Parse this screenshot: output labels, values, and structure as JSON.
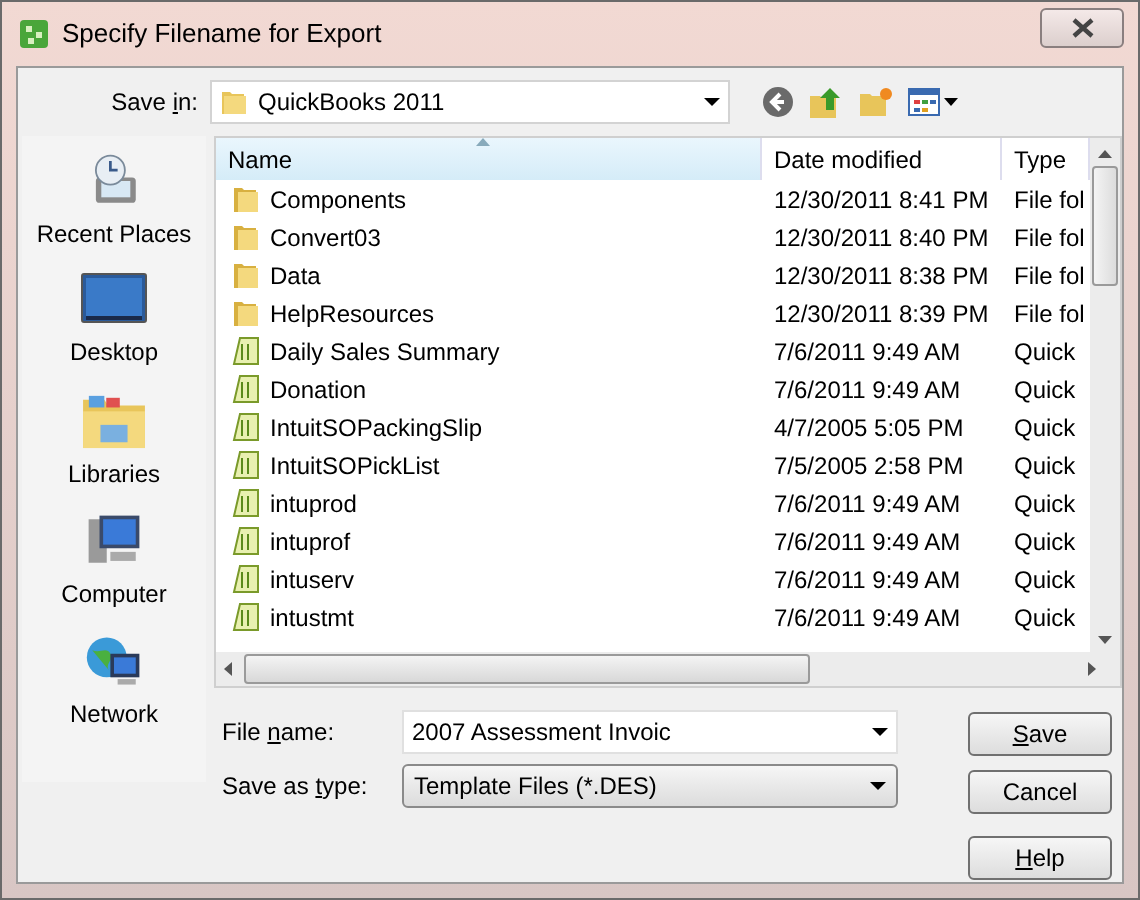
{
  "window": {
    "title": "Specify Filename for Export"
  },
  "save_in": {
    "label": [
      {
        "text": "Save ",
        "underlined": false
      },
      {
        "text": "i",
        "underlined": true
      },
      {
        "text": "n:",
        "underlined": false
      }
    ],
    "value": "QuickBooks 2011"
  },
  "places": [
    {
      "kind": "recent",
      "label": "Recent Places"
    },
    {
      "kind": "desktop",
      "label": "Desktop"
    },
    {
      "kind": "libraries",
      "label": "Libraries"
    },
    {
      "kind": "computer",
      "label": "Computer"
    },
    {
      "kind": "network",
      "label": "Network"
    }
  ],
  "columns": [
    {
      "label": "Name",
      "sorted": true
    },
    {
      "label": "Date modified",
      "sorted": false
    },
    {
      "label": "Type",
      "sorted": false
    }
  ],
  "files": [
    {
      "kind": "folder",
      "name": "Components",
      "date": "12/30/2011 8:41 PM",
      "type": "File fol"
    },
    {
      "kind": "folder",
      "name": "Convert03",
      "date": "12/30/2011 8:40 PM",
      "type": "File fol"
    },
    {
      "kind": "folder",
      "name": "Data",
      "date": "12/30/2011 8:38 PM",
      "type": "File fol"
    },
    {
      "kind": "folder",
      "name": "HelpResources",
      "date": "12/30/2011 8:39 PM",
      "type": "File fol"
    },
    {
      "kind": "template",
      "name": "Daily Sales Summary",
      "date": "7/6/2011 9:49 AM",
      "type": "Quick"
    },
    {
      "kind": "template",
      "name": "Donation",
      "date": "7/6/2011 9:49 AM",
      "type": "Quick"
    },
    {
      "kind": "template",
      "name": "IntuitSOPackingSlip",
      "date": "4/7/2005 5:05 PM",
      "type": "Quick"
    },
    {
      "kind": "template",
      "name": "IntuitSOPickList",
      "date": "7/5/2005 2:58 PM",
      "type": "Quick"
    },
    {
      "kind": "template",
      "name": "intuprod",
      "date": "7/6/2011 9:49 AM",
      "type": "Quick"
    },
    {
      "kind": "template",
      "name": "intuprof",
      "date": "7/6/2011 9:49 AM",
      "type": "Quick"
    },
    {
      "kind": "template",
      "name": "intuserv",
      "date": "7/6/2011 9:49 AM",
      "type": "Quick"
    },
    {
      "kind": "template",
      "name": "intustmt",
      "date": "7/6/2011 9:49 AM",
      "type": "Quick"
    }
  ],
  "file_name": {
    "label": [
      {
        "text": "File ",
        "underlined": false
      },
      {
        "text": "n",
        "underlined": true
      },
      {
        "text": "ame:",
        "underlined": false
      }
    ],
    "value": "2007 Assessment Invoic"
  },
  "save_as_type": {
    "label": [
      {
        "text": "Save as ",
        "underlined": false
      },
      {
        "text": "t",
        "underlined": true
      },
      {
        "text": "ype:",
        "underlined": false
      }
    ],
    "value": "Template Files (*.DES)"
  },
  "buttons": [
    {
      "label": [
        {
          "text": "S",
          "underlined": true
        },
        {
          "text": "ave",
          "underlined": false
        }
      ]
    },
    {
      "label": [
        {
          "text": "Cancel",
          "underlined": false
        }
      ]
    },
    {
      "label": [
        {
          "text": "H",
          "underlined": true
        },
        {
          "text": "elp",
          "underlined": false
        }
      ]
    }
  ]
}
